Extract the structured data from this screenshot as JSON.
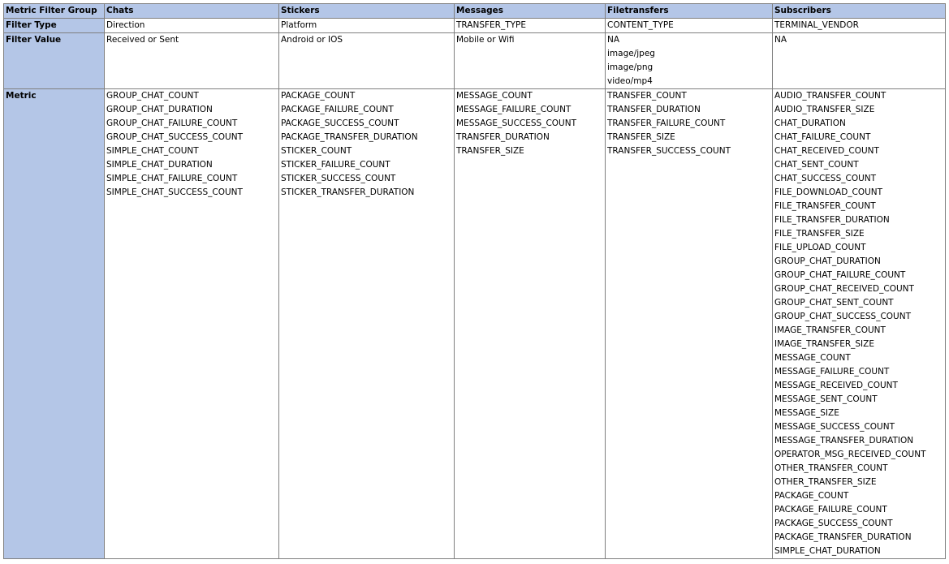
{
  "header": {
    "corner": "Metric Filter Group",
    "columns": [
      "Chats",
      "Stickers",
      "Messages",
      "Filetransfers",
      "Subscribers"
    ]
  },
  "filter_type": {
    "label": "Filter Type",
    "values": [
      "Direction",
      "Platform",
      "TRANSFER_TYPE",
      "CONTENT_TYPE",
      "TERMINAL_VENDOR"
    ]
  },
  "filter_value": {
    "label": "Filter Value",
    "values": [
      [
        "Received or Sent"
      ],
      [
        "Android or IOS"
      ],
      [
        "Mobile or Wifi"
      ],
      [
        "NA",
        "image/jpeg",
        "image/png",
        "video/mp4"
      ],
      [
        "NA"
      ]
    ]
  },
  "metric": {
    "label": "Metric",
    "values": [
      [
        "GROUP_CHAT_COUNT",
        "GROUP_CHAT_DURATION",
        "GROUP_CHAT_FAILURE_COUNT",
        "GROUP_CHAT_SUCCESS_COUNT",
        "SIMPLE_CHAT_COUNT",
        "SIMPLE_CHAT_DURATION",
        "SIMPLE_CHAT_FAILURE_COUNT",
        "SIMPLE_CHAT_SUCCESS_COUNT"
      ],
      [
        "PACKAGE_COUNT",
        "PACKAGE_FAILURE_COUNT",
        "PACKAGE_SUCCESS_COUNT",
        "PACKAGE_TRANSFER_DURATION",
        "STICKER_COUNT",
        "STICKER_FAILURE_COUNT",
        "STICKER_SUCCESS_COUNT",
        "STICKER_TRANSFER_DURATION"
      ],
      [
        "MESSAGE_COUNT",
        "MESSAGE_FAILURE_COUNT",
        "MESSAGE_SUCCESS_COUNT",
        "TRANSFER_DURATION",
        "TRANSFER_SIZE"
      ],
      [
        "TRANSFER_COUNT",
        "TRANSFER_DURATION",
        "TRANSFER_FAILURE_COUNT",
        "TRANSFER_SIZE",
        "TRANSFER_SUCCESS_COUNT"
      ],
      [
        "AUDIO_TRANSFER_COUNT",
        "AUDIO_TRANSFER_SIZE",
        "CHAT_DURATION",
        "CHAT_FAILURE_COUNT",
        "CHAT_RECEIVED_COUNT",
        "CHAT_SENT_COUNT",
        "CHAT_SUCCESS_COUNT",
        "FILE_DOWNLOAD_COUNT",
        "FILE_TRANSFER_COUNT",
        "FILE_TRANSFER_DURATION",
        "FILE_TRANSFER_SIZE",
        "FILE_UPLOAD_COUNT",
        "GROUP_CHAT_DURATION",
        "GROUP_CHAT_FAILURE_COUNT",
        "GROUP_CHAT_RECEIVED_COUNT",
        "GROUP_CHAT_SENT_COUNT",
        "GROUP_CHAT_SUCCESS_COUNT",
        "IMAGE_TRANSFER_COUNT",
        "IMAGE_TRANSFER_SIZE",
        "MESSAGE_COUNT",
        "MESSAGE_FAILURE_COUNT",
        "MESSAGE_RECEIVED_COUNT",
        "MESSAGE_SENT_COUNT",
        "MESSAGE_SIZE",
        "MESSAGE_SUCCESS_COUNT",
        "MESSAGE_TRANSFER_DURATION",
        "OPERATOR_MSG_RECEIVED_COUNT",
        "OTHER_TRANSFER_COUNT",
        "OTHER_TRANSFER_SIZE",
        "PACKAGE_COUNT",
        "PACKAGE_FAILURE_COUNT",
        "PACKAGE_SUCCESS_COUNT",
        "PACKAGE_TRANSFER_DURATION",
        "SIMPLE_CHAT_DURATION"
      ]
    ]
  }
}
